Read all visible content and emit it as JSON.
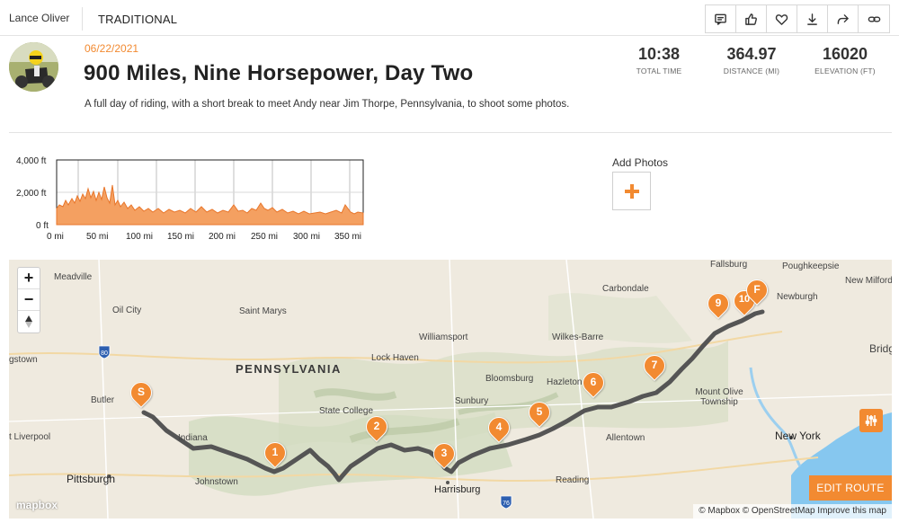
{
  "user": {
    "name": "Lance Oliver"
  },
  "activity_type": "TRADITIONAL",
  "toolbar": {
    "icons": [
      "comment-icon",
      "thumbs-up-icon",
      "heart-icon",
      "download-icon",
      "share-icon",
      "link-icon"
    ]
  },
  "ride": {
    "date": "06/22/2021",
    "title": "900 Miles, Nine Horsepower, Day Two",
    "description": "A full day of riding, with a short break to meet Andy near Jim Thorpe, Pennsylvania, to shoot some photos."
  },
  "stats": [
    {
      "value": "10:38",
      "label": "TOTAL TIME"
    },
    {
      "value": "364.97",
      "label": "DISTANCE (MI)"
    },
    {
      "value": "16020",
      "label": "ELEVATION (FT)"
    }
  ],
  "elevation": {
    "y_ticks": [
      "4,000 ft",
      "2,000 ft",
      "0 ft"
    ],
    "x_ticks": [
      "0 mi",
      "50 mi",
      "100 mi",
      "150 mi",
      "200 mi",
      "250 mi",
      "300 mi",
      "350 mi"
    ],
    "color": "#f28a31"
  },
  "add_photos": {
    "label": "Add Photos",
    "icon": "plus-icon"
  },
  "map": {
    "state_label": "PENNSYLVANIA",
    "places": [
      "Meadville",
      "Oil City",
      "Saint Marys",
      "Williamsport",
      "Lock Haven",
      "Carbondale",
      "Wilkes-Barre",
      "Bloomsburg",
      "Hazleton",
      "Sunbury",
      "State College",
      "Butler",
      "Indiana",
      "Johnstown",
      "Allentown",
      "Reading",
      "Mount Olive Township",
      "Fallsburg",
      "Poughkeepsie",
      "Newburgh",
      "New Milford",
      "Bridge",
      "gstown",
      "t Liverpool"
    ],
    "cities": [
      "Pittsburgh",
      "Harrisburg",
      "New York"
    ],
    "highway_shields": [
      "80",
      "76"
    ],
    "markers": [
      "S",
      "1",
      "2",
      "3",
      "4",
      "5",
      "6",
      "7",
      "9",
      "10",
      "F"
    ],
    "zoom": {
      "in": "+",
      "out": "−"
    },
    "edit_route": "EDIT ROUTE",
    "logo": "mapbox",
    "attribution": "© Mapbox © OpenStreetMap Improve this map",
    "route_color": "#555555",
    "accent": "#f28a31"
  }
}
